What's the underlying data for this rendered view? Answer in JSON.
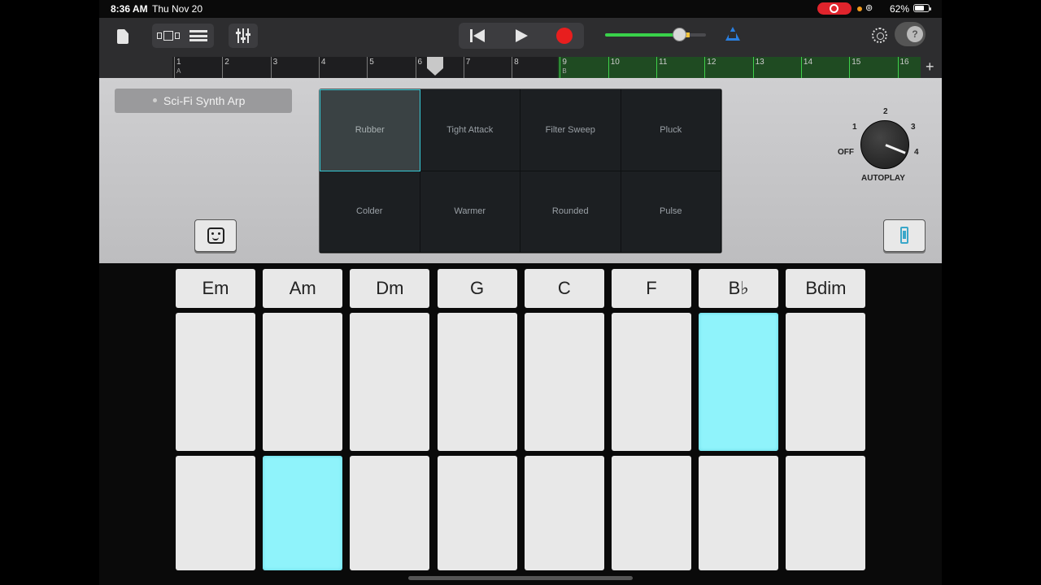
{
  "status_bar": {
    "time": "8:36 AM",
    "date": "Thu Nov 20",
    "battery": "62%"
  },
  "toolbar": {
    "icons": [
      "document-icon",
      "track-view-icon",
      "list-view-icon",
      "mixer-icon",
      "rewind-icon",
      "play-icon",
      "record-icon",
      "metronome-icon",
      "settings-icon",
      "help-icon"
    ],
    "volume_level": 0.73,
    "help_glyph": "?",
    "colors": {
      "record": "#e81e1e",
      "volume": "#39d14a",
      "metronome": "#2a7fe0"
    }
  },
  "ruler": {
    "bars": [
      "1",
      "2",
      "3",
      "4",
      "5",
      "6",
      "7",
      "8",
      "9",
      "10",
      "11",
      "12",
      "13",
      "14",
      "15",
      "16"
    ],
    "section_a": "A",
    "section_b": "B",
    "add_label": "+"
  },
  "panel": {
    "patch_name": "Sci-Fi Synth Arp",
    "xy_pads": [
      "Rubber",
      "Tight Attack",
      "Filter Sweep",
      "Pluck",
      "Colder",
      "Warmer",
      "Rounded",
      "Pulse"
    ],
    "selected_pad": "Rubber",
    "autoplay": {
      "label": "AUTOPLAY",
      "off": "OFF",
      "p1": "1",
      "p2": "2",
      "p3": "3",
      "p4": "4",
      "value": "4"
    }
  },
  "chords": [
    {
      "name": "Em",
      "top_active": false,
      "bottom_active": false
    },
    {
      "name": "Am",
      "top_active": false,
      "bottom_active": true
    },
    {
      "name": "Dm",
      "top_active": false,
      "bottom_active": false
    },
    {
      "name": "G",
      "top_active": false,
      "bottom_active": false
    },
    {
      "name": "C",
      "top_active": false,
      "bottom_active": false
    },
    {
      "name": "F",
      "top_active": false,
      "bottom_active": false
    },
    {
      "name": "B♭",
      "top_active": true,
      "bottom_active": false
    },
    {
      "name": "Bdim",
      "top_active": false,
      "bottom_active": false
    }
  ]
}
